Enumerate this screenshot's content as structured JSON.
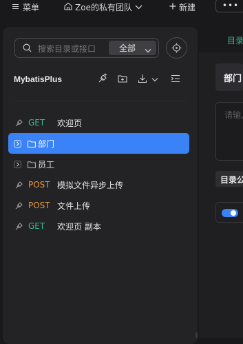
{
  "topbar": {
    "menu_label": "菜单",
    "team_label": "Zoe的私有团队",
    "new_label": "新建",
    "more_label": "•••"
  },
  "sidebar": {
    "search_placeholder": "搜索目录或接口",
    "scope_label": "全部",
    "project_title": "MybatisPlus",
    "tree": [
      {
        "type": "api",
        "method": "GET",
        "label": "欢迎页"
      },
      {
        "type": "folder",
        "label": "部门",
        "expanded": false,
        "selected": true
      },
      {
        "type": "folder",
        "label": "员工",
        "expanded": false,
        "selected": false
      },
      {
        "type": "api",
        "method": "POST",
        "label": "模拟文件异步上传"
      },
      {
        "type": "api",
        "method": "POST",
        "label": "文件上传"
      },
      {
        "type": "api",
        "method": "GET",
        "label": "欢迎页 副本"
      }
    ]
  },
  "right_panel": {
    "tab_label": "目录",
    "title": "部门",
    "desc_placeholder": "请输入",
    "section_label": "目录公"
  },
  "colors": {
    "accent": "#3b82f6",
    "get": "#3fb68b",
    "post": "#e8963c",
    "background": "#19191b",
    "sidebar": "#232326"
  },
  "icons": [
    "menu-icon",
    "team-icon",
    "chevron-down-icon",
    "plus-icon",
    "search-icon",
    "locate-icon",
    "new-api-icon",
    "new-folder-icon",
    "import-icon",
    "collapse-icon",
    "link-icon",
    "folder-icon",
    "chevron-right-icon"
  ]
}
